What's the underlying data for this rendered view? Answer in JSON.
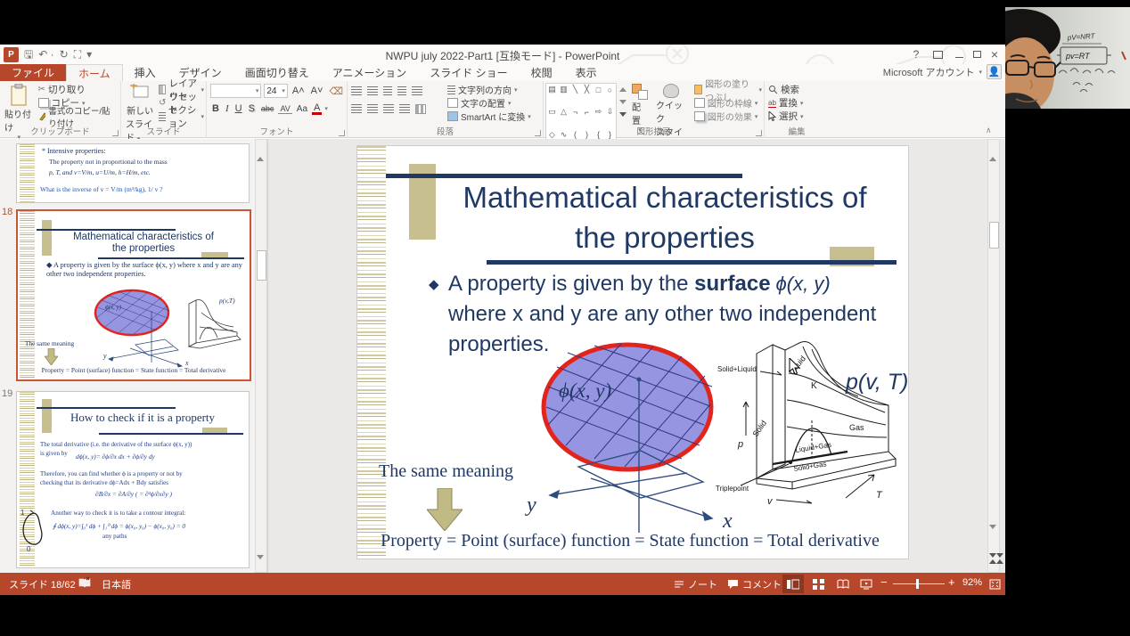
{
  "titlebar": {
    "logo": "P",
    "title": "NWPU july 2022-Part1 [互換モード] - PowerPoint",
    "help": "?",
    "account": "Microsoft アカウント"
  },
  "tabs": {
    "file": "ファイル",
    "home": "ホーム",
    "insert": "挿入",
    "design": "デザイン",
    "transitions": "画面切り替え",
    "animations": "アニメーション",
    "slideshow": "スライド ショー",
    "review": "校閲",
    "view": "表示"
  },
  "ribbon": {
    "clipboard": {
      "label": "クリップボード",
      "paste": "貼り付け",
      "cut": "切り取り",
      "copy": "コピー",
      "format_painter": "書式のコピー/貼り付け"
    },
    "slides": {
      "label": "スライド",
      "new1": "新しい",
      "new2": "スライド",
      "layout": "レイアウト",
      "reset": "リセット",
      "section": "セクション"
    },
    "font": {
      "label": "フォント",
      "size": "24",
      "bold": "B",
      "italic": "I",
      "underline": "U",
      "shadow": "S",
      "strike": "abc",
      "spacing": "AV",
      "case": "Aa",
      "color": "A"
    },
    "paragraph": {
      "label": "段落",
      "text_direction": "文字列の方向",
      "align_text": "文字の配置",
      "smartart": "SmartArt に変換"
    },
    "drawing": {
      "label": "図形描画",
      "arrange": "配置",
      "quick1": "クイック",
      "quick2": "スタイル",
      "fill": "図形の塗りつぶし",
      "outline": "図形の枠線",
      "effects": "図形の効果"
    },
    "editing": {
      "label": "編集",
      "find": "検索",
      "replace": "置換",
      "select": "選択"
    }
  },
  "thumbnails": {
    "prev": {
      "l1": "* Intensive properties:",
      "l2": "The property not in proportional to the mass",
      "l3": "p, T, and v=V/m, u=U/m, h=H/m, etc.",
      "l4": "What is the inverse of v = V/m   (m³/kg), 1/ v ?"
    },
    "s18": {
      "number": "18",
      "title1": "Mathematical characteristics of",
      "title2": "the properties",
      "bullet": "◆ A property is given by the surface ϕ(x, y) where x and y are any other two independent properties.",
      "phi": "ϕ(x, y)",
      "same": "The same meaning",
      "bottom": "Property = Point (surface) function = State function = Total derivative",
      "x": "x",
      "y": "y",
      "pvt": "p(v,T)"
    },
    "s19": {
      "number": "19",
      "title": "How to check if it is a property",
      "l1": "The total derivative (i.e. the derivative of the surface ϕ(x, y))",
      "l2": "is given by",
      "f1": "dϕ(x, y)= ∂ϕ/∂x dx + ∂ϕ/∂y dy",
      "l3": "Therefore, you can find whether ϕ is a property or not by",
      "l4": "checking that its derivative   dϕ=Adx + Bdy   satisfies",
      "f2": "∂B/∂x = ∂A/∂y ( = ∂²ϕ/∂x∂y )",
      "l5": "Another way to check it is to take a contour integral:",
      "f3": "∮ dϕ(x, y)=∫₀¹ dϕ + ∫₁⁰ dϕ = ϕ(x₀, y₀) − ϕ(x₀, y₀) = 0",
      "l6": "any paths",
      "n1": "1",
      "n0": "0"
    }
  },
  "slide": {
    "title1": "Mathematical characteristics of",
    "title2": "the properties",
    "bullet_glyph": "◆",
    "b1": "A property is given by the ",
    "b2": "surface",
    "b3": "ϕ(x, y)",
    "b4": "where x and y are any other two independent",
    "b5": "properties.",
    "phi": "ϕ(x, y)",
    "axis_x": "x",
    "axis_y": "y",
    "same": "The same meaning",
    "bottom": "Property = Point (surface) function = State function = Total derivative",
    "pvt": {
      "fn": "p(v, T)",
      "solid_liquid": "Solid+Liquid",
      "liquid": "Liquid",
      "k": "K",
      "gas": "Gas",
      "liquid_gas": "Liquid+Gas",
      "solid_gas": "Solid+Gas",
      "solid": "Solid",
      "triple": "Triplepoint",
      "p": "p",
      "v": "v",
      "t": "T"
    }
  },
  "statusbar": {
    "slide_counter": "スライド 18/62",
    "language": "日本語",
    "notes": "ノート",
    "comments": "コメント",
    "zoom": "92%"
  },
  "webcam": {
    "board1": "pV=NRT",
    "board2": "pv=RT"
  },
  "colors": {
    "accent": "#B7472A",
    "navy": "#1F3864",
    "tan": "#C7BF8F",
    "selection_border": "#CC5633",
    "ellipse_fill": "#9595E2",
    "ellipse_border": "#E3241C"
  }
}
